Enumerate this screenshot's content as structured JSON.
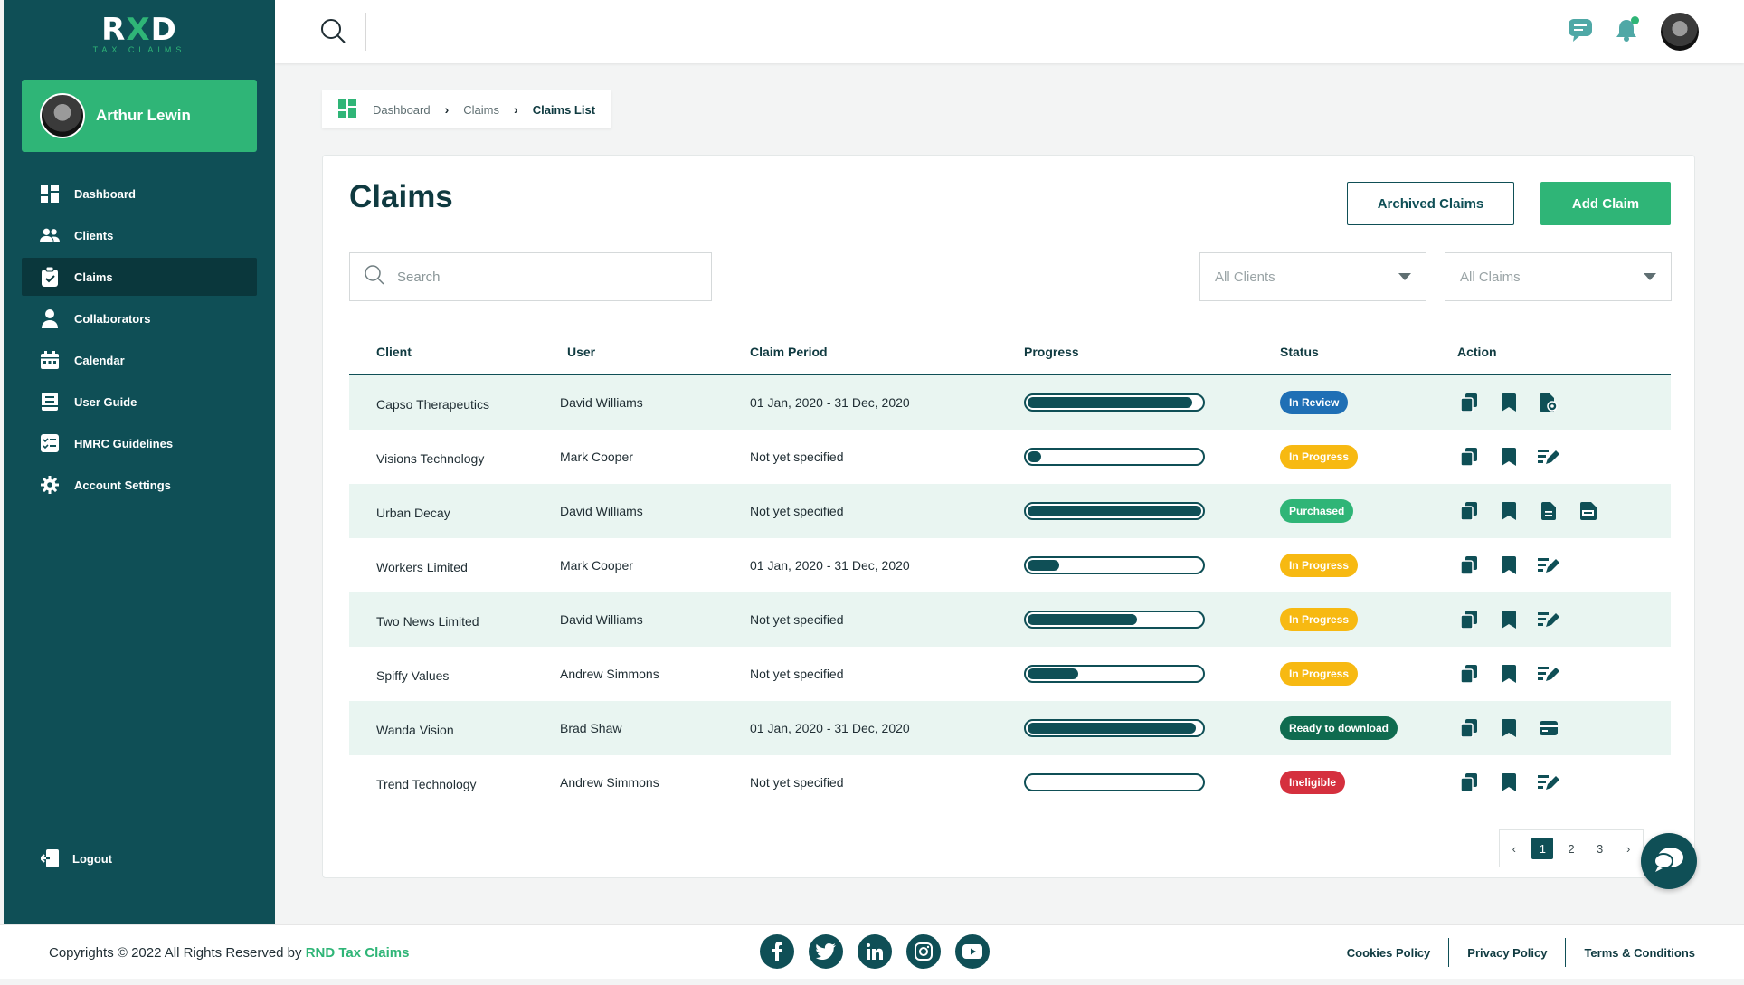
{
  "brand": {
    "logo_left": "R",
    "logo_x": "X",
    "logo_right": "D",
    "logo_sub": "TAX CLAIMS"
  },
  "user": {
    "name": "Arthur Lewin"
  },
  "colors": {
    "primary": "#0f4f56",
    "accent": "#2fb577",
    "review": "#1f6fb5",
    "progress": "#f7b912",
    "ineligible": "#d5303e"
  },
  "sidebar": {
    "items": [
      {
        "label": "Dashboard",
        "icon": "grid-icon"
      },
      {
        "label": "Clients",
        "icon": "users-icon"
      },
      {
        "label": "Claims",
        "icon": "clipboard-icon",
        "active": true
      },
      {
        "label": "Collaborators",
        "icon": "person-icon"
      },
      {
        "label": "Calendar",
        "icon": "calendar-icon"
      },
      {
        "label": "User Guide",
        "icon": "guide-icon"
      },
      {
        "label": "HMRC Guidelines",
        "icon": "checklist-icon"
      },
      {
        "label": "Account Settings",
        "icon": "gear-icon"
      }
    ],
    "logout": "Logout"
  },
  "breadcrumb": {
    "items": [
      "Dashboard",
      "Claims"
    ],
    "current": "Claims List"
  },
  "page": {
    "title": "Claims",
    "archived_button": "Archived Claims",
    "add_button": "Add Claim",
    "search_placeholder": "Search",
    "filter_clients": "All Clients",
    "filter_claims": "All Claims"
  },
  "table": {
    "headers": {
      "client": "Client",
      "user": "User",
      "period": "Claim Period",
      "progress": "Progress",
      "status": "Status",
      "action": "Action"
    },
    "rows": [
      {
        "client": "Capso Therapeutics",
        "user": "David Williams",
        "period": "01 Jan, 2020 - 31 Dec, 2020",
        "progress": 0.95,
        "status": "In Review",
        "status_type": "review",
        "actions": [
          "copy-icon",
          "bookmark-icon",
          "document-gear-icon"
        ]
      },
      {
        "client": "Visions Technology",
        "user": "Mark Cooper",
        "period": "Not yet specified",
        "progress": 0.08,
        "status": "In Progress",
        "status_type": "progress",
        "actions": [
          "copy-icon",
          "bookmark-icon",
          "edit-list-icon"
        ]
      },
      {
        "client": "Urban Decay",
        "user": "David Williams",
        "period": "Not yet specified",
        "progress": 1.0,
        "status": "Purchased",
        "status_type": "purchased",
        "actions": [
          "copy-icon",
          "bookmark-icon",
          "document-icon",
          "pdf-icon"
        ]
      },
      {
        "client": "Workers Limited",
        "user": "Mark Cooper",
        "period": "01 Jan, 2020 - 31 Dec, 2020",
        "progress": 0.18,
        "status": "In Progress",
        "status_type": "progress",
        "actions": [
          "copy-icon",
          "bookmark-icon",
          "edit-list-icon"
        ]
      },
      {
        "client": "Two News Limited",
        "user": "David Williams",
        "period": "Not yet specified",
        "progress": 0.63,
        "status": "In Progress",
        "status_type": "progress",
        "actions": [
          "copy-icon",
          "bookmark-icon",
          "edit-list-icon"
        ]
      },
      {
        "client": "Spiffy Values",
        "user": "Andrew Simmons",
        "period": "Not yet specified",
        "progress": 0.29,
        "status": "In Progress",
        "status_type": "progress",
        "actions": [
          "copy-icon",
          "bookmark-icon",
          "edit-list-icon"
        ]
      },
      {
        "client": "Wanda Vision",
        "user": "Brad Shaw",
        "period": "01 Jan, 2020 - 31 Dec, 2020",
        "progress": 0.97,
        "status": "Ready to download",
        "status_type": "ready",
        "actions": [
          "copy-icon",
          "bookmark-icon",
          "card-icon"
        ]
      },
      {
        "client": "Trend Technology",
        "user": "Andrew Simmons",
        "period": "Not yet specified",
        "progress": 0.0,
        "status": "Ineligible",
        "status_type": "ineligible",
        "actions": [
          "copy-icon",
          "bookmark-icon",
          "edit-list-icon"
        ]
      }
    ]
  },
  "pagination": {
    "pages": [
      "1",
      "2",
      "3"
    ],
    "current": "1"
  },
  "footer": {
    "copyright_prefix": "Copyrights © 2022 All Rights Reserved by",
    "copyright_brand": "RND Tax Claims",
    "socials": [
      "facebook-icon",
      "twitter-icon",
      "linkedin-icon",
      "instagram-icon",
      "youtube-icon"
    ],
    "links": [
      "Cookies Policy",
      "Privacy Policy",
      "Terms & Conditions"
    ]
  }
}
